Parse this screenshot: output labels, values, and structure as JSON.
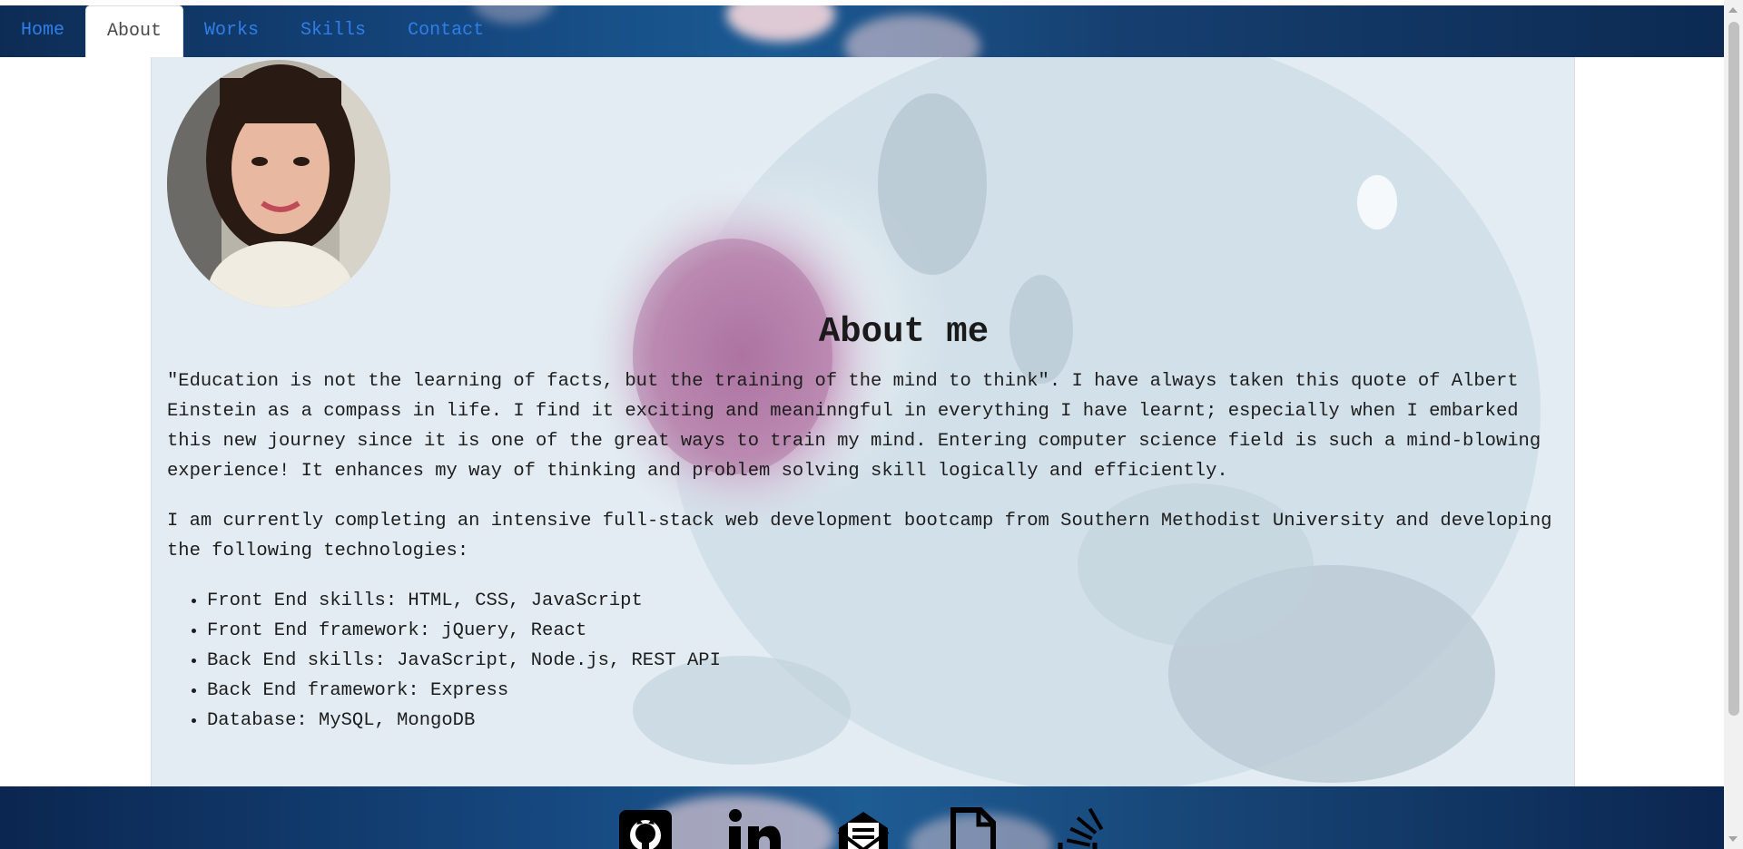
{
  "nav": {
    "tabs": [
      {
        "label": "Home"
      },
      {
        "label": "About"
      },
      {
        "label": "Works"
      },
      {
        "label": "Skills"
      },
      {
        "label": "Contact"
      }
    ],
    "active_tab": "About"
  },
  "about": {
    "title": "About me",
    "paragraph1": "\"Education is not the learning of facts, but the training of the mind to think\". I have always taken this quote of Albert Einstein as a compass in life. I find it exciting and meaninngful in everything I have learnt; especially when I embarked this new journey since it is one of the great ways to train my mind. Entering computer science field is such a mind-blowing experience! It enhances my way of thinking and problem solving skill logically and efficiently.",
    "paragraph2": "I am currently completing an intensive full-stack web development bootcamp from Southern Methodist University and developing the following technologies:",
    "skills": [
      "Front End skills: HTML, CSS, JavaScript",
      "Front End framework: jQuery, React",
      "Back End skills: JavaScript, Node.js, REST API",
      "Back End framework: Express",
      "Database: MySQL, MongoDB"
    ]
  },
  "footer": {
    "icons": [
      "github-icon",
      "linkedin-icon",
      "email-icon",
      "resume-icon",
      "stackoverflow-icon"
    ]
  },
  "colors": {
    "nav_link": "#2f7fe8",
    "nav_active_text": "#494949",
    "content_bg": "#e2ecf2",
    "header_bg": "#14457c"
  }
}
